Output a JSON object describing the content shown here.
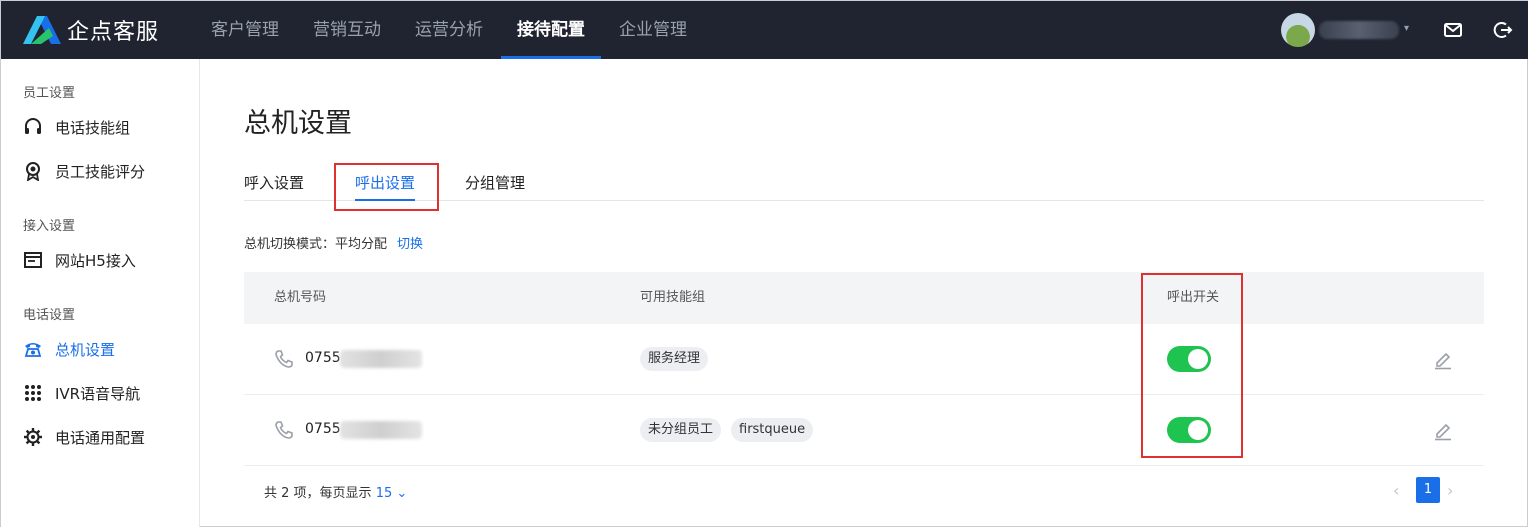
{
  "app": {
    "name": "企点客服"
  },
  "nav": {
    "items": [
      {
        "label": "客户管理"
      },
      {
        "label": "营销互动"
      },
      {
        "label": "运营分析"
      },
      {
        "label": "接待配置",
        "active": true
      },
      {
        "label": "企业管理"
      }
    ]
  },
  "header": {
    "user_dropdown_icon": "caret-down-icon",
    "mail_icon": "mail-icon",
    "logout_icon": "logout-icon"
  },
  "sidebar": {
    "groups": [
      {
        "label": "员工设置",
        "items": [
          {
            "label": "电话技能组",
            "icon": "headset-icon"
          },
          {
            "label": "员工技能评分",
            "icon": "award-icon"
          }
        ]
      },
      {
        "label": "接入设置",
        "items": [
          {
            "label": "网站H5接入",
            "icon": "web-window-icon"
          }
        ]
      },
      {
        "label": "电话设置",
        "items": [
          {
            "label": "总机设置",
            "icon": "telephone-icon",
            "active": true
          },
          {
            "label": "IVR语音导航",
            "icon": "grid-dots-icon"
          },
          {
            "label": "电话通用配置",
            "icon": "gear-icon"
          }
        ]
      }
    ]
  },
  "main": {
    "title": "总机设置",
    "tabs": [
      {
        "label": "呼入设置"
      },
      {
        "label": "呼出设置",
        "active": true
      },
      {
        "label": "分组管理"
      }
    ],
    "mode": {
      "label": "总机切换模式：平均分配",
      "switch_label": "切换"
    },
    "table": {
      "headers": [
        "总机号码",
        "可用技能组",
        "呼出开关"
      ],
      "rows": [
        {
          "number": "0755",
          "groups": [
            "服务经理"
          ],
          "outbound_enabled": true
        },
        {
          "number": "0755",
          "groups": [
            "未分组员工",
            "firstqueue"
          ],
          "outbound_enabled": true
        }
      ]
    },
    "pagination": {
      "total_text": "共 2 项，每页显示",
      "page_size": "15",
      "current_page": "1"
    }
  },
  "colors": {
    "nav_bg": "#1f2430",
    "accent": "#1a6fe8",
    "toggle_on": "#1ec44f",
    "highlight_box": "#e03131"
  }
}
